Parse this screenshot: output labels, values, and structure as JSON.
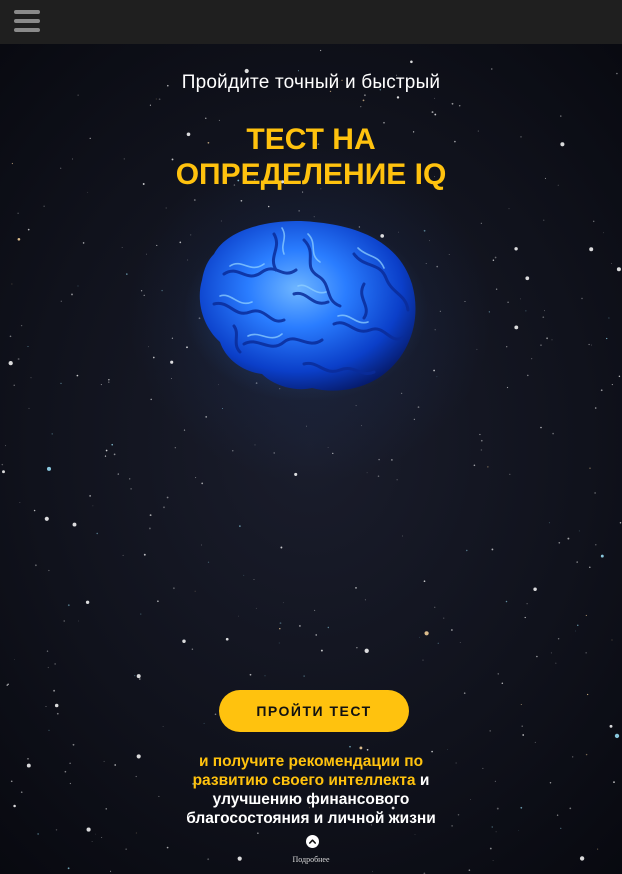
{
  "header": {
    "menu_icon": "hamburger-menu-icon"
  },
  "hero": {
    "subtitle": "Пройдите точный и быстрый",
    "headline": "ТЕСТ НА ОПРЕДЕЛЕНИЕ IQ",
    "image": "blue-brain",
    "cta_label": "ПРОЙТИ ТЕСТ",
    "promo_highlight": "и получите рекомендации по развитию своего интеллекта",
    "promo_rest": " и улучшению финансового благосостояния и личной жизни",
    "more_icon": "chevron-up-circle-icon",
    "more_label": "Подробнее"
  },
  "colors": {
    "accent": "#ffc20e",
    "background": "#0b0d16",
    "topbar": "#1f1f1f",
    "brain": "#1e6cff"
  }
}
